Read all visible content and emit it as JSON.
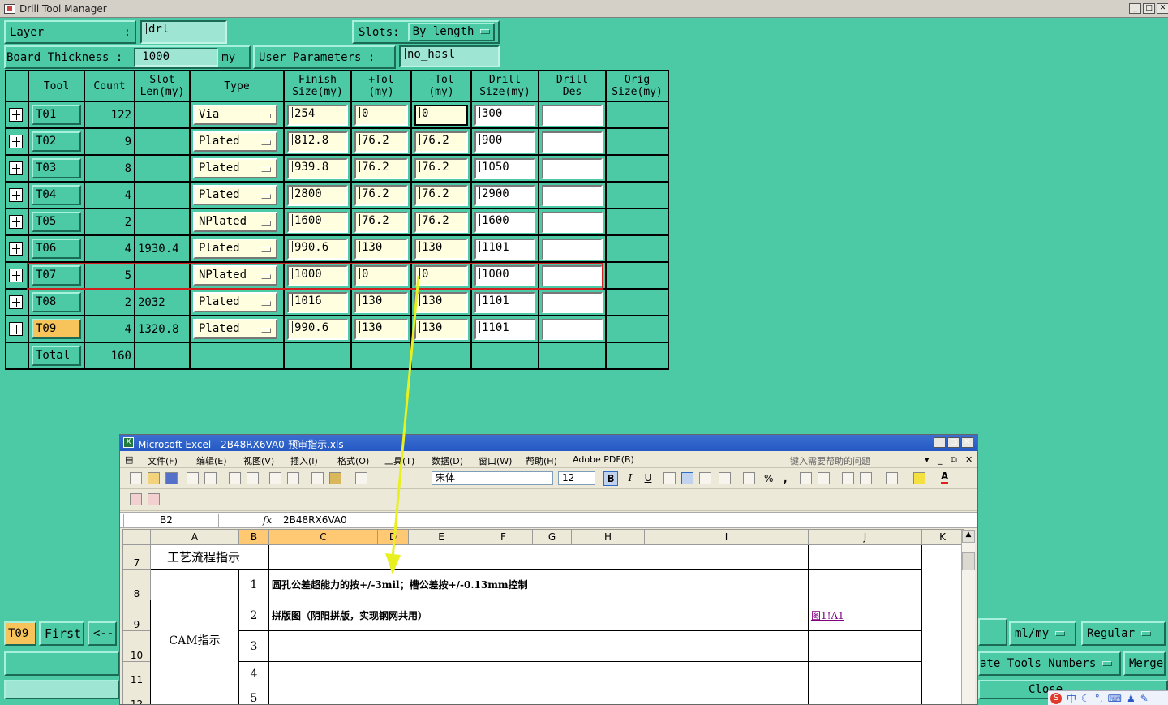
{
  "window": {
    "title": "Drill Tool Manager"
  },
  "form": {
    "layer_label": "Layer",
    "layer_colon": ":",
    "layer_value": "drl",
    "slots_label": "Slots:",
    "slots_value": "By length",
    "thickness_label": "Board Thickness :",
    "thickness_value": "1000",
    "thickness_unit": "my",
    "user_params_label": "User Parameters :",
    "user_params_value": "no_hasl"
  },
  "grid": {
    "headers": [
      "Tool",
      "Count",
      "Slot\nLen(my)",
      "Type",
      "Finish\nSize(my)",
      "+Tol\n(my)",
      "-Tol\n(my)",
      "Drill\nSize(my)",
      "Drill\nDes",
      "Orig\nSize(my)"
    ],
    "rows": [
      {
        "tool": "T01",
        "count": "122",
        "slot": "",
        "type": "Via",
        "finish": "254",
        "ptol": "0",
        "mtol": "0",
        "drill": "300"
      },
      {
        "tool": "T02",
        "count": "9",
        "slot": "",
        "type": "Plated",
        "finish": "812.8",
        "ptol": "76.2",
        "mtol": "76.2",
        "drill": "900"
      },
      {
        "tool": "T03",
        "count": "8",
        "slot": "",
        "type": "Plated",
        "finish": "939.8",
        "ptol": "76.2",
        "mtol": "76.2",
        "drill": "1050"
      },
      {
        "tool": "T04",
        "count": "4",
        "slot": "",
        "type": "Plated",
        "finish": "2800",
        "ptol": "76.2",
        "mtol": "76.2",
        "drill": "2900"
      },
      {
        "tool": "T05",
        "count": "2",
        "slot": "",
        "type": "NPlated",
        "finish": "1600",
        "ptol": "76.2",
        "mtol": "76.2",
        "drill": "1600"
      },
      {
        "tool": "T06",
        "count": "4",
        "slot": "1930.4",
        "type": "Plated",
        "finish": "990.6",
        "ptol": "130",
        "mtol": "130",
        "drill": "1101"
      },
      {
        "tool": "T07",
        "count": "5",
        "slot": "",
        "type": "NPlated",
        "finish": "1000",
        "ptol": "0",
        "mtol": "0",
        "drill": "1000"
      },
      {
        "tool": "T08",
        "count": "2",
        "slot": "2032",
        "type": "Plated",
        "finish": "1016",
        "ptol": "130",
        "mtol": "130",
        "drill": "1101"
      },
      {
        "tool": "T09",
        "count": "4",
        "slot": "1320.8",
        "type": "Plated",
        "finish": "990.6",
        "ptol": "130",
        "mtol": "130",
        "drill": "1101"
      }
    ],
    "total_label": "Total",
    "total_count": "160"
  },
  "bottom": {
    "current_tool": "T09",
    "first_label": "First",
    "prev_label": "<--",
    "units_value": "ml/my",
    "style_value": "Regular",
    "tools_numbers_label": "ate Tools Numbers",
    "merge_label": "Merge",
    "close_label": "Close"
  },
  "excel": {
    "title": "Microsoft Excel - 2B48RX6VA0-预审指示.xls",
    "menu": [
      "文件(F)",
      "编辑(E)",
      "视图(V)",
      "插入(I)",
      "格式(O)",
      "工具(T)",
      "数据(D)",
      "窗口(W)",
      "帮助(H)",
      "Adobe PDF(B)"
    ],
    "help_placeholder": "键入需要帮助的问题",
    "font_name": "宋体",
    "font_size": "12",
    "fmt_bold": "B",
    "fmt_italic": "I",
    "fmt_underline": "U",
    "fmt_percent": "%",
    "fmt_comma": ",",
    "name_box": "B2",
    "fx": "fx",
    "formula": "2B48RX6VA0",
    "columns": [
      "A",
      "B",
      "C",
      "D",
      "E",
      "F",
      "G",
      "H",
      "I",
      "J",
      "K"
    ],
    "row_numbers": [
      "7",
      "8",
      "9",
      "10",
      "11",
      "12"
    ],
    "row7_label": "工艺流程指示",
    "cam_label": "CAM指示",
    "items": [
      {
        "no": "1",
        "text": "圆孔公差超能力的按+/-3mil；槽公差按+/-0.13mm控制",
        "link": ""
      },
      {
        "no": "2",
        "text": "拼版图（阴阳拼版，实现钢网共用）",
        "link": "图1!A1"
      },
      {
        "no": "3",
        "text": "",
        "link": ""
      },
      {
        "no": "4",
        "text": "",
        "link": ""
      },
      {
        "no": "5",
        "text": "",
        "link": ""
      }
    ]
  },
  "tray": {
    "ime_label": "中"
  },
  "colors": {
    "background": "#4ccaa6",
    "input_bg": "#ffffe0",
    "selected_tool": "#f6c45a",
    "highlight": "#d02020",
    "arrow": "#e8f020"
  }
}
